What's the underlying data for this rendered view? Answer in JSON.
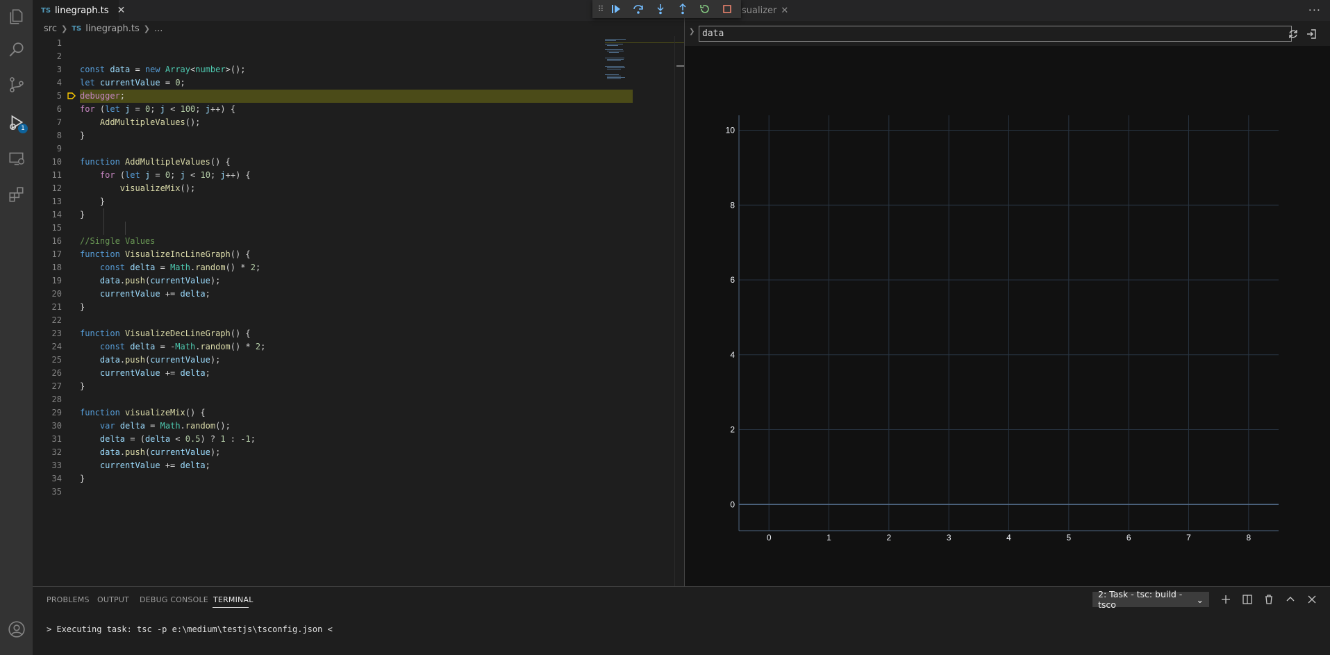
{
  "activity_bar": {
    "debug_badge": "1"
  },
  "editor": {
    "tab": {
      "lang": "TS",
      "filename": "linegraph.ts"
    },
    "breadcrumb": {
      "folder": "src",
      "lang": "TS",
      "file": "linegraph.ts",
      "more": "..."
    }
  },
  "visualizer": {
    "tab_label": "sualizer",
    "expression": "data",
    "more": "···"
  },
  "chart_data": {
    "type": "line",
    "x_ticks": [
      "0",
      "1",
      "2",
      "3",
      "4",
      "5",
      "6",
      "7",
      "8"
    ],
    "y_ticks": [
      "0",
      "2",
      "4",
      "6",
      "8",
      "10"
    ],
    "xlim": [
      -0.5,
      8.5
    ],
    "ylim": [
      -0.7,
      10.4
    ],
    "grid": true,
    "series": []
  },
  "panel": {
    "tabs": [
      "PROBLEMS",
      "OUTPUT",
      "DEBUG CONSOLE",
      "TERMINAL"
    ],
    "active_tab": "TERMINAL",
    "terminal_select": "2: Task - tsc: build - tsco",
    "terminal_text": "> Executing task: tsc -p e:\\medium\\testjs\\tsconfig.json <"
  }
}
